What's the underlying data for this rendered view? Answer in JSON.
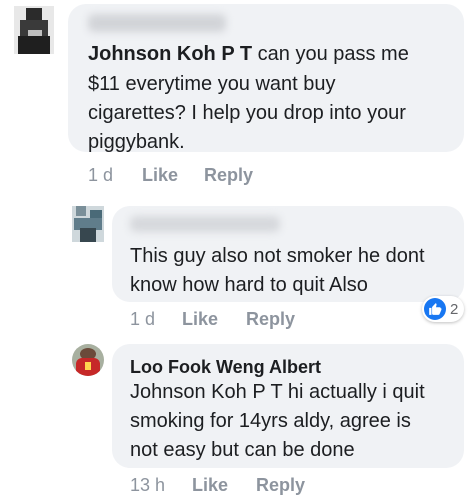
{
  "comments": [
    {
      "author": "",
      "mention": "Johnson Koh P T",
      "body_lines": [
        "can you pass me",
        "$11 everytime you want buy",
        "cigarettes? I help you drop into your",
        "piggybank."
      ],
      "time": "1 d",
      "like_label": "Like",
      "reply_label": "Reply"
    },
    {
      "author": "",
      "body_lines": [
        "This guy also not smoker he dont",
        "know how hard to quit Also"
      ],
      "time": "1 d",
      "like_label": "Like",
      "reply_label": "Reply",
      "reactions": {
        "icon": "thumbs-up-icon",
        "count": "2"
      }
    },
    {
      "author": "Loo Fook Weng Albert",
      "mention": "Johnson Koh P T",
      "body_lines": [
        "hi actually i quit",
        "smoking for 14yrs aldy, agree is",
        "not easy but can be done"
      ],
      "time": "13 h",
      "like_label": "Like",
      "reply_label": "Reply"
    }
  ],
  "colors": {
    "bubble": "#f0f2f5",
    "meta_text": "#8d949e",
    "like_blue": "#1877f2"
  }
}
